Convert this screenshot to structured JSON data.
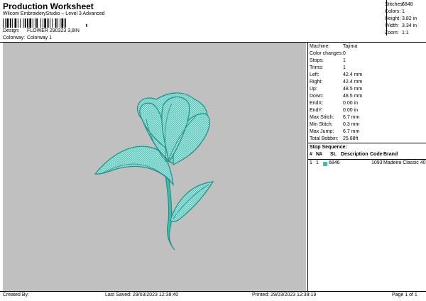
{
  "header": {
    "title": "Production Worksheet",
    "subtitle": "Wilcom EmbroideryStudio – Level 3 Advanced",
    "barcode_tail": ","
  },
  "design": {
    "design_label": "Design:",
    "design_value": "FLOWER 290323 3,8IN",
    "colorway_label": "Colorway:",
    "colorway_value": "Colorway 1"
  },
  "stats": [
    {
      "label": "Stitches:",
      "value": "6848"
    },
    {
      "label": "Colors:",
      "value": "1"
    },
    {
      "label": "Height:",
      "value": "3.82 in"
    },
    {
      "label": "Width:",
      "value": "3.34 in"
    },
    {
      "label": "Zoom:",
      "value": "1:1"
    }
  ],
  "machine": [
    {
      "label": "Machine:",
      "value": "Tajima"
    },
    {
      "label": "Color changes:",
      "value": "0"
    },
    {
      "label": "Stops:",
      "value": "1"
    },
    {
      "label": "Trims:",
      "value": "1"
    },
    {
      "label": "Left:",
      "value": "42.4 mm"
    },
    {
      "label": "Right:",
      "value": "42.4 mm"
    },
    {
      "label": "Up:",
      "value": "48.5 mm"
    },
    {
      "label": "Down:",
      "value": "48.5 mm"
    },
    {
      "label": "EndX:",
      "value": "0.00 in"
    },
    {
      "label": "EndY:",
      "value": "0.00 in"
    },
    {
      "label": "Max Stitch:",
      "value": "6.7 mm"
    },
    {
      "label": "Min Stitch:",
      "value": "0.3 mm"
    },
    {
      "label": "Max Jump:",
      "value": "6.7 mm"
    },
    {
      "label": "Total Bobbin:",
      "value": "25.88ft"
    }
  ],
  "stop_sequence": {
    "title": "Stop Sequence:",
    "headers": [
      "#",
      "N#",
      "",
      "St.",
      "Description",
      "Code",
      "Brand"
    ],
    "rows": [
      {
        "index": "1",
        "needle": "1",
        "color": "#3cc0b4",
        "stitches": "6846",
        "description": "",
        "code": "1093",
        "brand": "Madeira Classic 40"
      }
    ]
  },
  "footer": {
    "created_by": "Created By:",
    "last_saved": "Last Saved: 29/03/2023 12:38:40",
    "printed": "Printed: 29/03/2023 12:39:19",
    "page": "Page 1 of 1"
  },
  "colors": {
    "thread": "#3cc0b4",
    "thread_dark": "#1f8f86",
    "canvas_bg": "#c0c0c0"
  },
  "icons": {
    "design_preview": "flower-embroidery-icon"
  }
}
